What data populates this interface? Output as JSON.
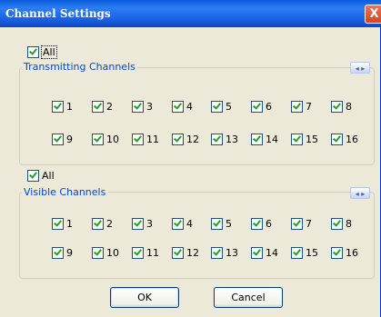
{
  "dialog": {
    "title": "Channel Settings",
    "close_glyph": "X"
  },
  "transmitting": {
    "all_label": "All",
    "legend": "Transmitting Channels",
    "arrows": "◂ ▸",
    "channels": [
      "1",
      "2",
      "3",
      "4",
      "5",
      "6",
      "7",
      "8",
      "9",
      "10",
      "11",
      "12",
      "13",
      "14",
      "15",
      "16"
    ]
  },
  "visible": {
    "all_label": "All",
    "legend": "Visible Channels",
    "arrows": "◂ ▸",
    "channels": [
      "1",
      "2",
      "3",
      "4",
      "5",
      "6",
      "7",
      "8",
      "9",
      "10",
      "11",
      "12",
      "13",
      "14",
      "15",
      "16"
    ]
  },
  "buttons": {
    "ok": "OK",
    "cancel": "Cancel"
  }
}
